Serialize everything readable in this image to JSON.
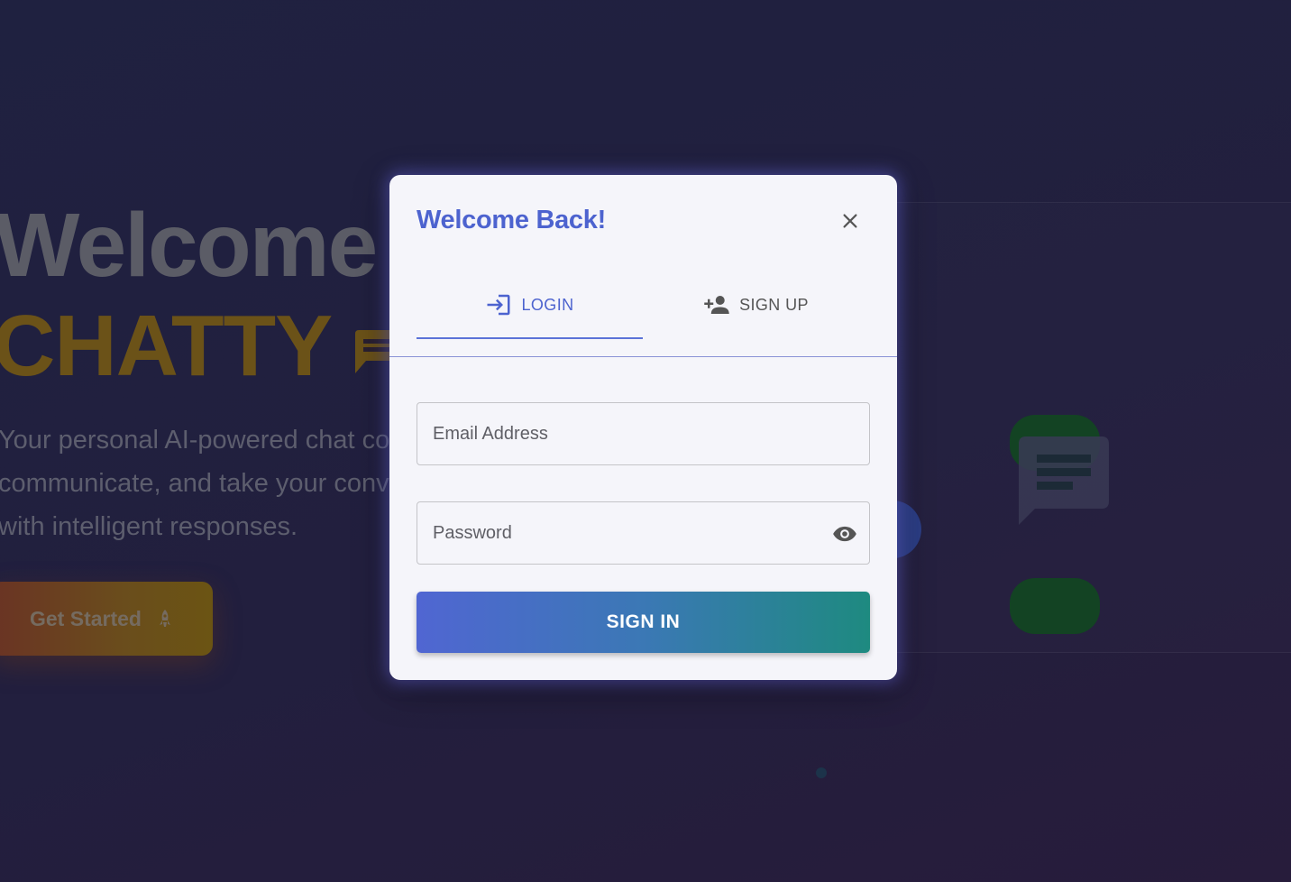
{
  "background": {
    "hero_title_line1": "Welcome t",
    "hero_title_line2": "CHATTY",
    "hero_description": "Your personal AI-powered chat co communicate, and take your conv level with intelligent responses.",
    "get_started_label": "Get Started"
  },
  "modal": {
    "title": "Welcome Back!",
    "tabs": [
      {
        "label": "LOGIN",
        "icon": "login-icon",
        "active": true
      },
      {
        "label": "SIGN UP",
        "icon": "person-add-icon",
        "active": false
      }
    ],
    "email_placeholder": "Email Address",
    "password_placeholder": "Password",
    "submit_label": "SIGN IN"
  },
  "colors": {
    "accent": "#4d63cf",
    "modal_bg": "#f5f5fa",
    "button_gradient_start": "#5066d2",
    "button_gradient_end": "#1e8a80"
  }
}
